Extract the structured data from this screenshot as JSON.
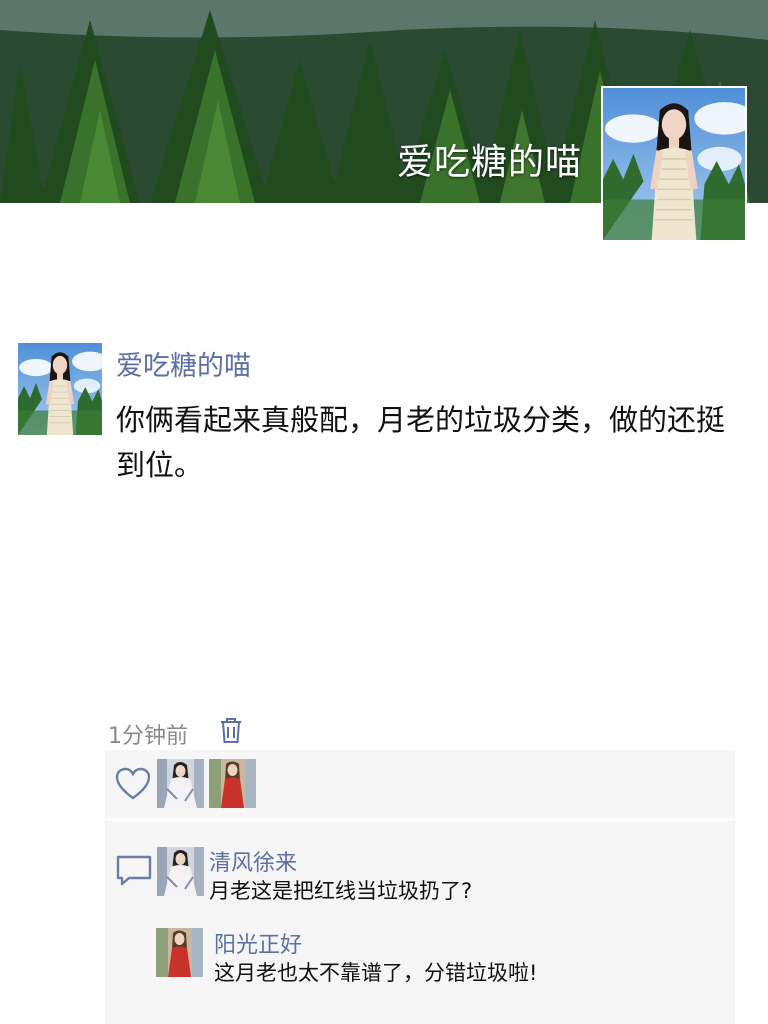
{
  "cover": {
    "name": "爱吃糖的喵"
  },
  "post": {
    "author": "爱吃糖的喵",
    "text": "你俩看起来真般配，月老的垃圾分类，做的还挺到位。",
    "time": "1分钟前"
  },
  "likes": {
    "avatars": [
      "avatar-girl-white-dress",
      "avatar-girl-red-dress"
    ]
  },
  "comments": [
    {
      "author": "清风徐来",
      "text": "月老这是把红线当垃圾扔了?"
    },
    {
      "author": "阳光正好",
      "text": "这月老也太不靠谱了，分错垃圾啦!"
    }
  ],
  "colors": {
    "link": "#5b6fa8",
    "panel": "#f6f6f6",
    "time": "#8a8a8a"
  },
  "icons": [
    "heart-icon",
    "comment-icon",
    "trash-icon"
  ]
}
